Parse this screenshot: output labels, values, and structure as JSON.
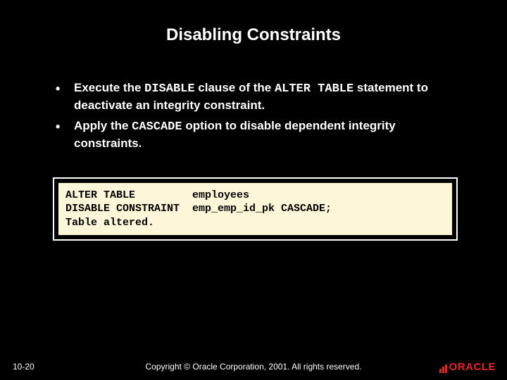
{
  "title": "Disabling Constraints",
  "bullets": [
    {
      "pre": "Execute the ",
      "code1": "DISABLE",
      "mid1": " clause of the ",
      "code2": "ALTER TABLE",
      "post": " statement to deactivate an integrity constraint."
    },
    {
      "pre": "Apply the ",
      "code1": "CASCADE",
      "mid1": " option to disable dependent integrity constraints.",
      "code2": "",
      "post": ""
    }
  ],
  "code": "ALTER TABLE         employees\nDISABLE CONSTRAINT  emp_emp_id_pk CASCADE;\nTable altered.",
  "footer": {
    "page": "10-20",
    "copyright": "Copyright © Oracle Corporation, 2001. All rights reserved.",
    "logo": "ORACLE"
  }
}
